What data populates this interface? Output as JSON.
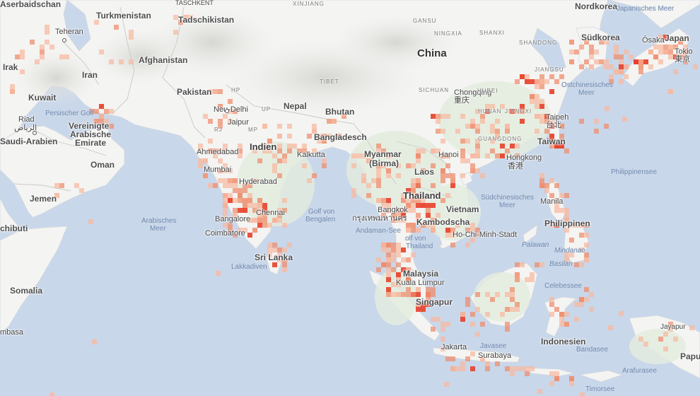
{
  "colors": {
    "ocean": "#c9d7ea",
    "land": "#f4f4f2",
    "vegetation": "#dfeadb",
    "mountain": "#e2e2de",
    "heat_low": "#f8b8a0",
    "heat_mid": "#f08a6a",
    "heat_high": "#e8402a"
  },
  "countries": {
    "azerbaijan": "Aserbaidschan",
    "turkmenistan": "Turkmenistan",
    "tajikistan": "Tadschikistan",
    "iraq": "Irak",
    "iran": "Iran",
    "afghanistan": "Afghanistan",
    "kuwait": "Kuwait",
    "pakistan": "Pakistan",
    "saudi_arabia": "Saudi-Arabien",
    "uae_line1": "Vereinigte",
    "uae_line2": "Arabische",
    "uae_line3": "Emirate",
    "oman": "Oman",
    "yemen": "Jemen",
    "djibouti": "chibuti",
    "somalia": "Somalia",
    "india": "Indien",
    "nepal": "Nepal",
    "bhutan": "Bhutan",
    "bangladesh": "Bangladesch",
    "myanmar_line1": "Myanmar",
    "myanmar_line2": "(Birma)",
    "china": "China",
    "laos": "Laos",
    "thailand": "Thailand",
    "vietnam": "Vietnam",
    "cambodia": "Kambodscha",
    "malaysia": "Malaysia",
    "singapore": "Singapur",
    "indonesia": "Indonesien",
    "philippines": "Philippinen",
    "north_korea": "Nordkorea",
    "south_korea": "Südkorea",
    "japan": "Japan",
    "taiwan": "Taiwan",
    "sri_lanka": "Sri Lanka",
    "papua": "Papu"
  },
  "cities": {
    "taschkent": "TASCHKENT",
    "tehran": "Teheran",
    "riyadh": "Riad",
    "riyadh_ar": "الرياض",
    "delhi": "Neu-Delhi",
    "jaipur": "Jaipur",
    "ahmedabad": "Ahmedabad",
    "mumbai": "Mumbai",
    "hyderabad": "Hyderabad",
    "chennai": "Chennai",
    "bangalore": "Bangalore",
    "coimbatore": "Coimbatore",
    "kolkata": "Kalkutta",
    "bangkok": "Bangkok",
    "bangkok_th": "กรุงเทพมหานคร",
    "hanoi": "Hanoi",
    "hcmc": "Ho-Chi-Minh-Stadt",
    "kuala_lumpur": "Kuala Lumpur",
    "jakarta": "Jakarta",
    "surabaya": "Surabaya",
    "hongkong": "Hongkong",
    "hongkong_zh": "香港",
    "taipei": "Taipeh",
    "taipei_zh": "台北",
    "chongqing": "Chongqing",
    "chongqing_zh": "重庆",
    "manila": "Manila",
    "tokyo": "Tokio",
    "tokyo_ja": "東京",
    "osaka": "Ōsaka"
  },
  "regions": {
    "xinjiang": "XINJIANG",
    "tibet": "TIBET",
    "gansu": "GANSU",
    "ningxia": "NINGXIA",
    "shanxi": "SHANXI",
    "shandong": "SHANDONG",
    "sichuan": "SICHUAN",
    "hubei": "HUBEI",
    "hunan": "HUNAN",
    "jiangxi": "JIANGXI",
    "jiangsu": "JIANGSU",
    "guangdong": "GUANGDONG",
    "up": "UP",
    "hp": "HP",
    "rj": "RJ",
    "mp": "MP"
  },
  "seas": {
    "persian_gulf": "Persischer Golf",
    "arabian_sea_1": "Arabisches",
    "arabian_sea_2": "Meer",
    "bengal_1": "Golf von",
    "bengal_2": "Bengalen",
    "andaman": "Andaman-See",
    "thailand_gulf_1": "olf von",
    "thailand_gulf_2": "Thailand",
    "scs_1": "Südchinesisches",
    "scs_2": "Meer",
    "ecs_1": "Ostchinesisches",
    "ecs_2": "Meer",
    "japan_sea": "Japanisches Meer",
    "philippine_sea": "Philippinensee",
    "celebes": "Celebessee",
    "java_sea": "Javasee",
    "banda": "Bandasee",
    "arafura": "Arafurasee",
    "timor": "Timorsee",
    "laccadive": "Lakkadiven"
  },
  "islands": {
    "palawan": "Palawan",
    "mindanao": "Mindanao",
    "basilan": "Basilan",
    "jayapura": "Jayapur",
    "mombasa": "mbasa"
  }
}
